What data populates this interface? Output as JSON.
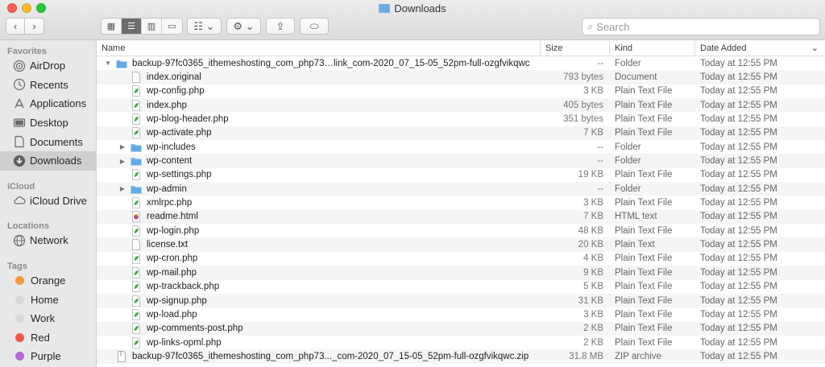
{
  "window": {
    "title": "Downloads"
  },
  "toolbar": {
    "back_label": "‹",
    "forward_label": "›",
    "arrange_label": "☷ ⌄",
    "action_label": "⚙ ⌄",
    "share_label": "⇪",
    "tags_label": "⬭",
    "search_placeholder": "Search"
  },
  "sidebar": {
    "favorites_label": "Favorites",
    "favorites": [
      {
        "label": "AirDrop",
        "icon": "airdrop-icon"
      },
      {
        "label": "Recents",
        "icon": "clock-icon"
      },
      {
        "label": "Applications",
        "icon": "applications-icon"
      },
      {
        "label": "Desktop",
        "icon": "desktop-icon"
      },
      {
        "label": "Documents",
        "icon": "document-icon"
      },
      {
        "label": "Downloads",
        "icon": "download-icon",
        "selected": true
      }
    ],
    "icloud_label": "iCloud",
    "icloud": [
      {
        "label": "iCloud Drive",
        "icon": "cloud-icon"
      }
    ],
    "locations_label": "Locations",
    "locations": [
      {
        "label": "Network",
        "icon": "globe-icon"
      }
    ],
    "tags_label": "Tags",
    "tags": [
      {
        "label": "Orange",
        "color": "#f39a3c"
      },
      {
        "label": "Home",
        "color": "#d8d8d8"
      },
      {
        "label": "Work",
        "color": "#d8d8d8"
      },
      {
        "label": "Red",
        "color": "#f0544b"
      },
      {
        "label": "Purple",
        "color": "#b669d6"
      }
    ]
  },
  "columns": {
    "name": "Name",
    "size": "Size",
    "kind": "Kind",
    "date": "Date Added",
    "date_sort_icon": "⌄"
  },
  "files": [
    {
      "name": "backup-97fc0365_ithemeshosting_com_php73…link_com-2020_07_15-05_52pm-full-ozgfvikqwc",
      "size": "--",
      "kind": "Folder",
      "date": "Today at 12:55 PM",
      "icon": "folder-icon",
      "level": 0,
      "disclosure": "▼"
    },
    {
      "name": "index.original",
      "size": "793 bytes",
      "kind": "Document",
      "date": "Today at 12:55 PM",
      "icon": "blank-document-icon",
      "level": 1,
      "disclosure": ""
    },
    {
      "name": "wp-config.php",
      "size": "3 KB",
      "kind": "Plain Text File",
      "date": "Today at 12:55 PM",
      "icon": "php-file-icon",
      "level": 1,
      "disclosure": ""
    },
    {
      "name": "index.php",
      "size": "405 bytes",
      "kind": "Plain Text File",
      "date": "Today at 12:55 PM",
      "icon": "php-file-icon",
      "level": 1,
      "disclosure": ""
    },
    {
      "name": "wp-blog-header.php",
      "size": "351 bytes",
      "kind": "Plain Text File",
      "date": "Today at 12:55 PM",
      "icon": "php-file-icon",
      "level": 1,
      "disclosure": ""
    },
    {
      "name": "wp-activate.php",
      "size": "7 KB",
      "kind": "Plain Text File",
      "date": "Today at 12:55 PM",
      "icon": "php-file-icon",
      "level": 1,
      "disclosure": ""
    },
    {
      "name": "wp-includes",
      "size": "--",
      "kind": "Folder",
      "date": "Today at 12:55 PM",
      "icon": "folder-icon",
      "level": 1,
      "disclosure": "▶"
    },
    {
      "name": "wp-content",
      "size": "--",
      "kind": "Folder",
      "date": "Today at 12:55 PM",
      "icon": "folder-icon",
      "level": 1,
      "disclosure": "▶"
    },
    {
      "name": "wp-settings.php",
      "size": "19 KB",
      "kind": "Plain Text File",
      "date": "Today at 12:55 PM",
      "icon": "php-file-icon",
      "level": 1,
      "disclosure": ""
    },
    {
      "name": "wp-admin",
      "size": "--",
      "kind": "Folder",
      "date": "Today at 12:55 PM",
      "icon": "folder-icon",
      "level": 1,
      "disclosure": "▶"
    },
    {
      "name": "xmlrpc.php",
      "size": "3 KB",
      "kind": "Plain Text File",
      "date": "Today at 12:55 PM",
      "icon": "php-file-icon",
      "level": 1,
      "disclosure": ""
    },
    {
      "name": "readme.html",
      "size": "7 KB",
      "kind": "HTML text",
      "date": "Today at 12:55 PM",
      "icon": "html-file-icon",
      "level": 1,
      "disclosure": ""
    },
    {
      "name": "wp-login.php",
      "size": "48 KB",
      "kind": "Plain Text File",
      "date": "Today at 12:55 PM",
      "icon": "php-file-icon",
      "level": 1,
      "disclosure": ""
    },
    {
      "name": "license.txt",
      "size": "20 KB",
      "kind": "Plain Text",
      "date": "Today at 12:55 PM",
      "icon": "blank-document-icon",
      "level": 1,
      "disclosure": ""
    },
    {
      "name": "wp-cron.php",
      "size": "4 KB",
      "kind": "Plain Text File",
      "date": "Today at 12:55 PM",
      "icon": "php-file-icon",
      "level": 1,
      "disclosure": ""
    },
    {
      "name": "wp-mail.php",
      "size": "9 KB",
      "kind": "Plain Text File",
      "date": "Today at 12:55 PM",
      "icon": "php-file-icon",
      "level": 1,
      "disclosure": ""
    },
    {
      "name": "wp-trackback.php",
      "size": "5 KB",
      "kind": "Plain Text File",
      "date": "Today at 12:55 PM",
      "icon": "php-file-icon",
      "level": 1,
      "disclosure": ""
    },
    {
      "name": "wp-signup.php",
      "size": "31 KB",
      "kind": "Plain Text File",
      "date": "Today at 12:55 PM",
      "icon": "php-file-icon",
      "level": 1,
      "disclosure": ""
    },
    {
      "name": "wp-load.php",
      "size": "3 KB",
      "kind": "Plain Text File",
      "date": "Today at 12:55 PM",
      "icon": "php-file-icon",
      "level": 1,
      "disclosure": ""
    },
    {
      "name": "wp-comments-post.php",
      "size": "2 KB",
      "kind": "Plain Text File",
      "date": "Today at 12:55 PM",
      "icon": "php-file-icon",
      "level": 1,
      "disclosure": ""
    },
    {
      "name": "wp-links-opml.php",
      "size": "2 KB",
      "kind": "Plain Text File",
      "date": "Today at 12:55 PM",
      "icon": "php-file-icon",
      "level": 1,
      "disclosure": ""
    },
    {
      "name": "backup-97fc0365_ithemeshosting_com_php73..._com-2020_07_15-05_52pm-full-ozgfvikqwc.zip",
      "size": "31.8 MB",
      "kind": "ZIP archive",
      "date": "Today at 12:55 PM",
      "icon": "zip-file-icon",
      "level": 0,
      "disclosure": ""
    }
  ]
}
